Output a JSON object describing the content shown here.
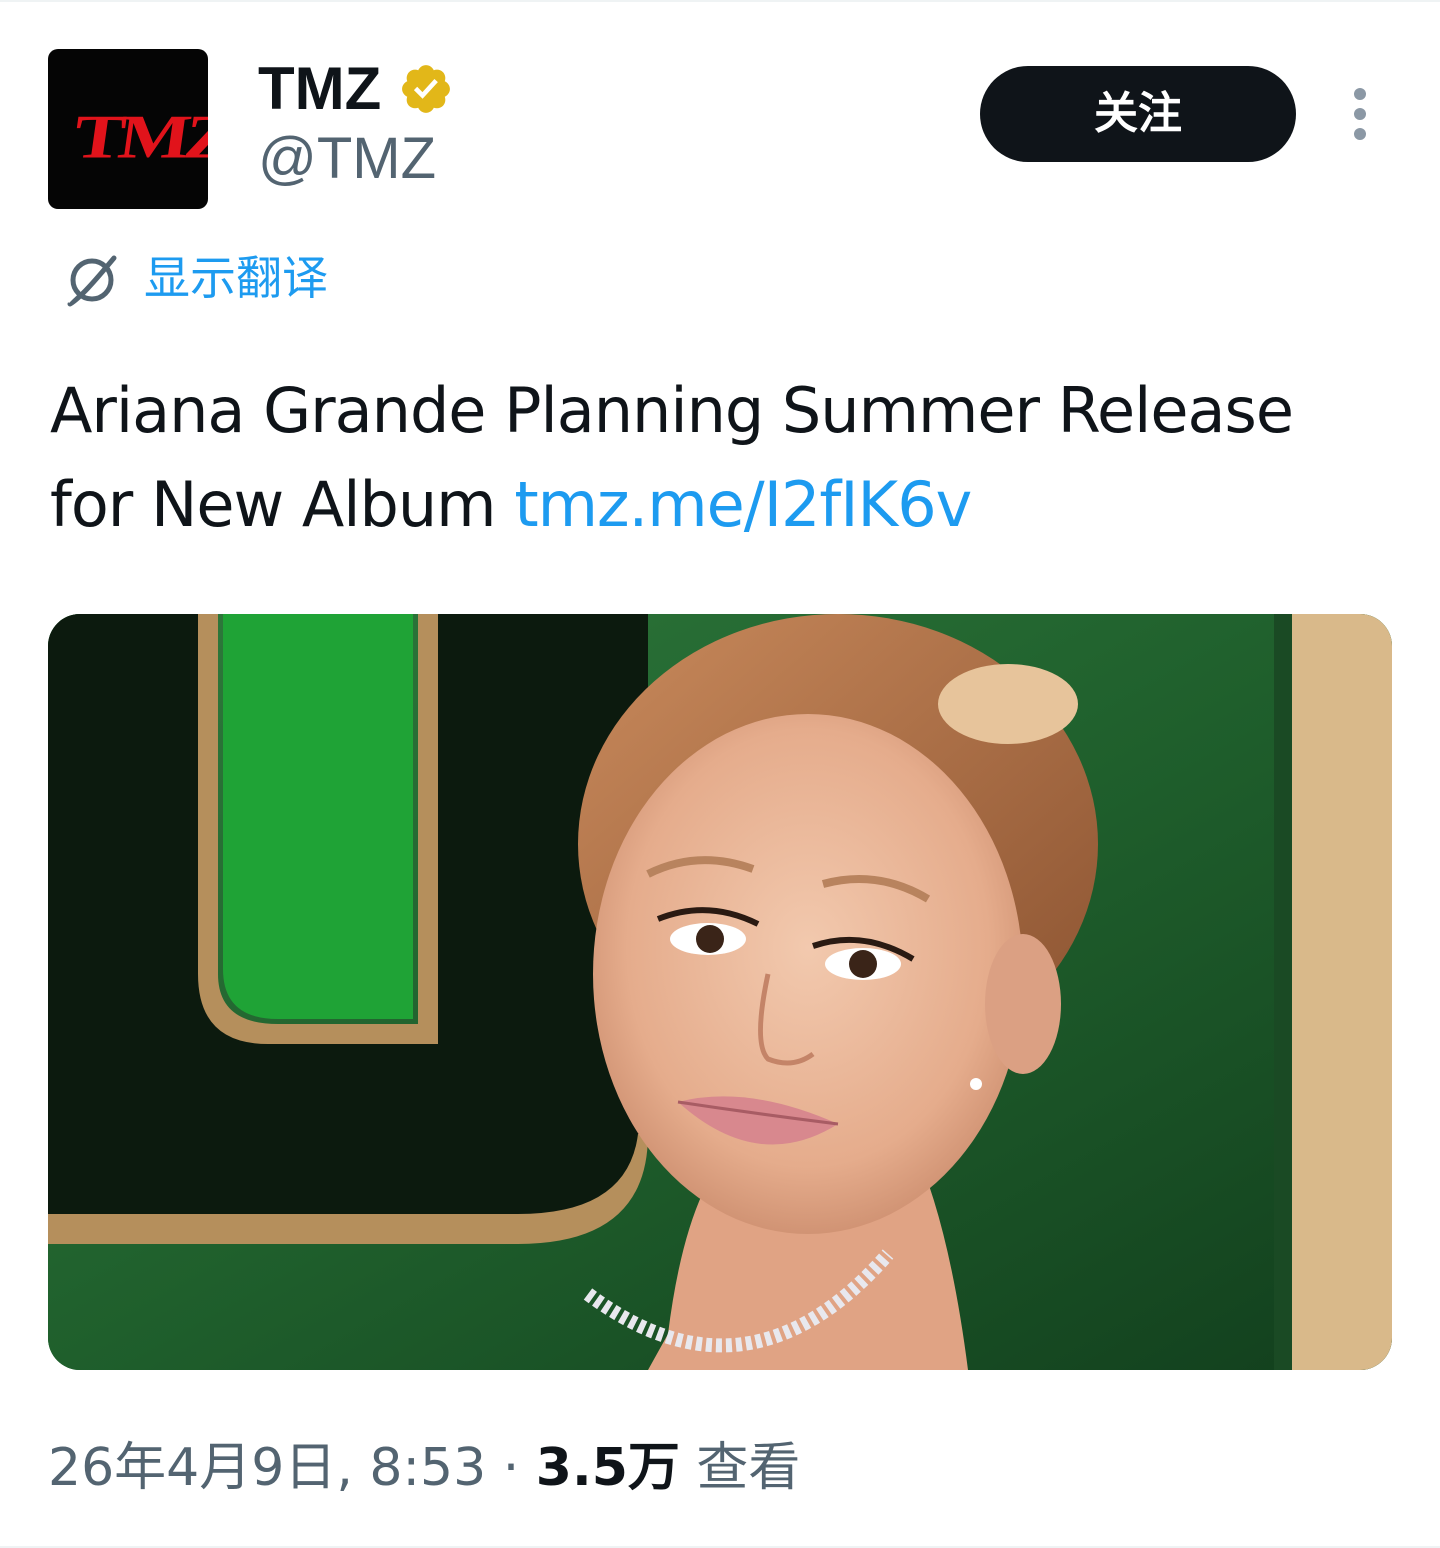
{
  "tweet": {
    "author": {
      "avatar_logo_text": "TMZ",
      "display_name": "TMZ",
      "handle": "@TMZ",
      "verified_icon": "verified-badge-gold"
    },
    "follow_label": "关注",
    "more_icon": "more-vertical-icon",
    "translate": {
      "icon": "globe-icon",
      "label": "显示翻译"
    },
    "text": "Ariana Grande Planning Summer Release for New Album",
    "link": "tmz.me/I2fIK6v",
    "media": {
      "kind": "photo"
    },
    "meta": {
      "date_time": "26年4月9日, 8:53",
      "separator": "·",
      "views_count": "3.5万",
      "views_label": "查看"
    }
  },
  "colors": {
    "text_primary": "#0f1419",
    "text_secondary": "#536471",
    "link": "#1d9bf0",
    "verified_gold": "#e2b719",
    "button_bg": "#0f1419",
    "logo_red": "#e1131b"
  }
}
